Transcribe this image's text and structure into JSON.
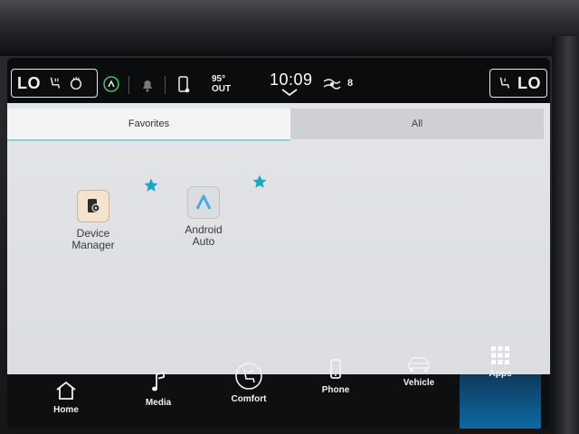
{
  "status": {
    "left_temp": "LO",
    "right_temp": "LO",
    "outside_temp": "95°",
    "outside_label": "OUT",
    "clock": "10:09",
    "fan_level": "8"
  },
  "tabs": [
    {
      "label": "Favorites",
      "selected": true
    },
    {
      "label": "All",
      "selected": false
    }
  ],
  "apps": [
    {
      "line1": "Device",
      "line2": "Manager"
    },
    {
      "line1": "Android",
      "line2": "Auto"
    }
  ],
  "nav": [
    {
      "label": "Home"
    },
    {
      "label": "Media"
    },
    {
      "label": "Comfort"
    },
    {
      "label": "Phone"
    },
    {
      "label": "Vehicle"
    },
    {
      "label": "Apps",
      "active": true
    }
  ],
  "colors": {
    "accent": "#0b6ca8",
    "star": "#1aa7c6",
    "android_auto_icon": "#4aa8e0"
  }
}
